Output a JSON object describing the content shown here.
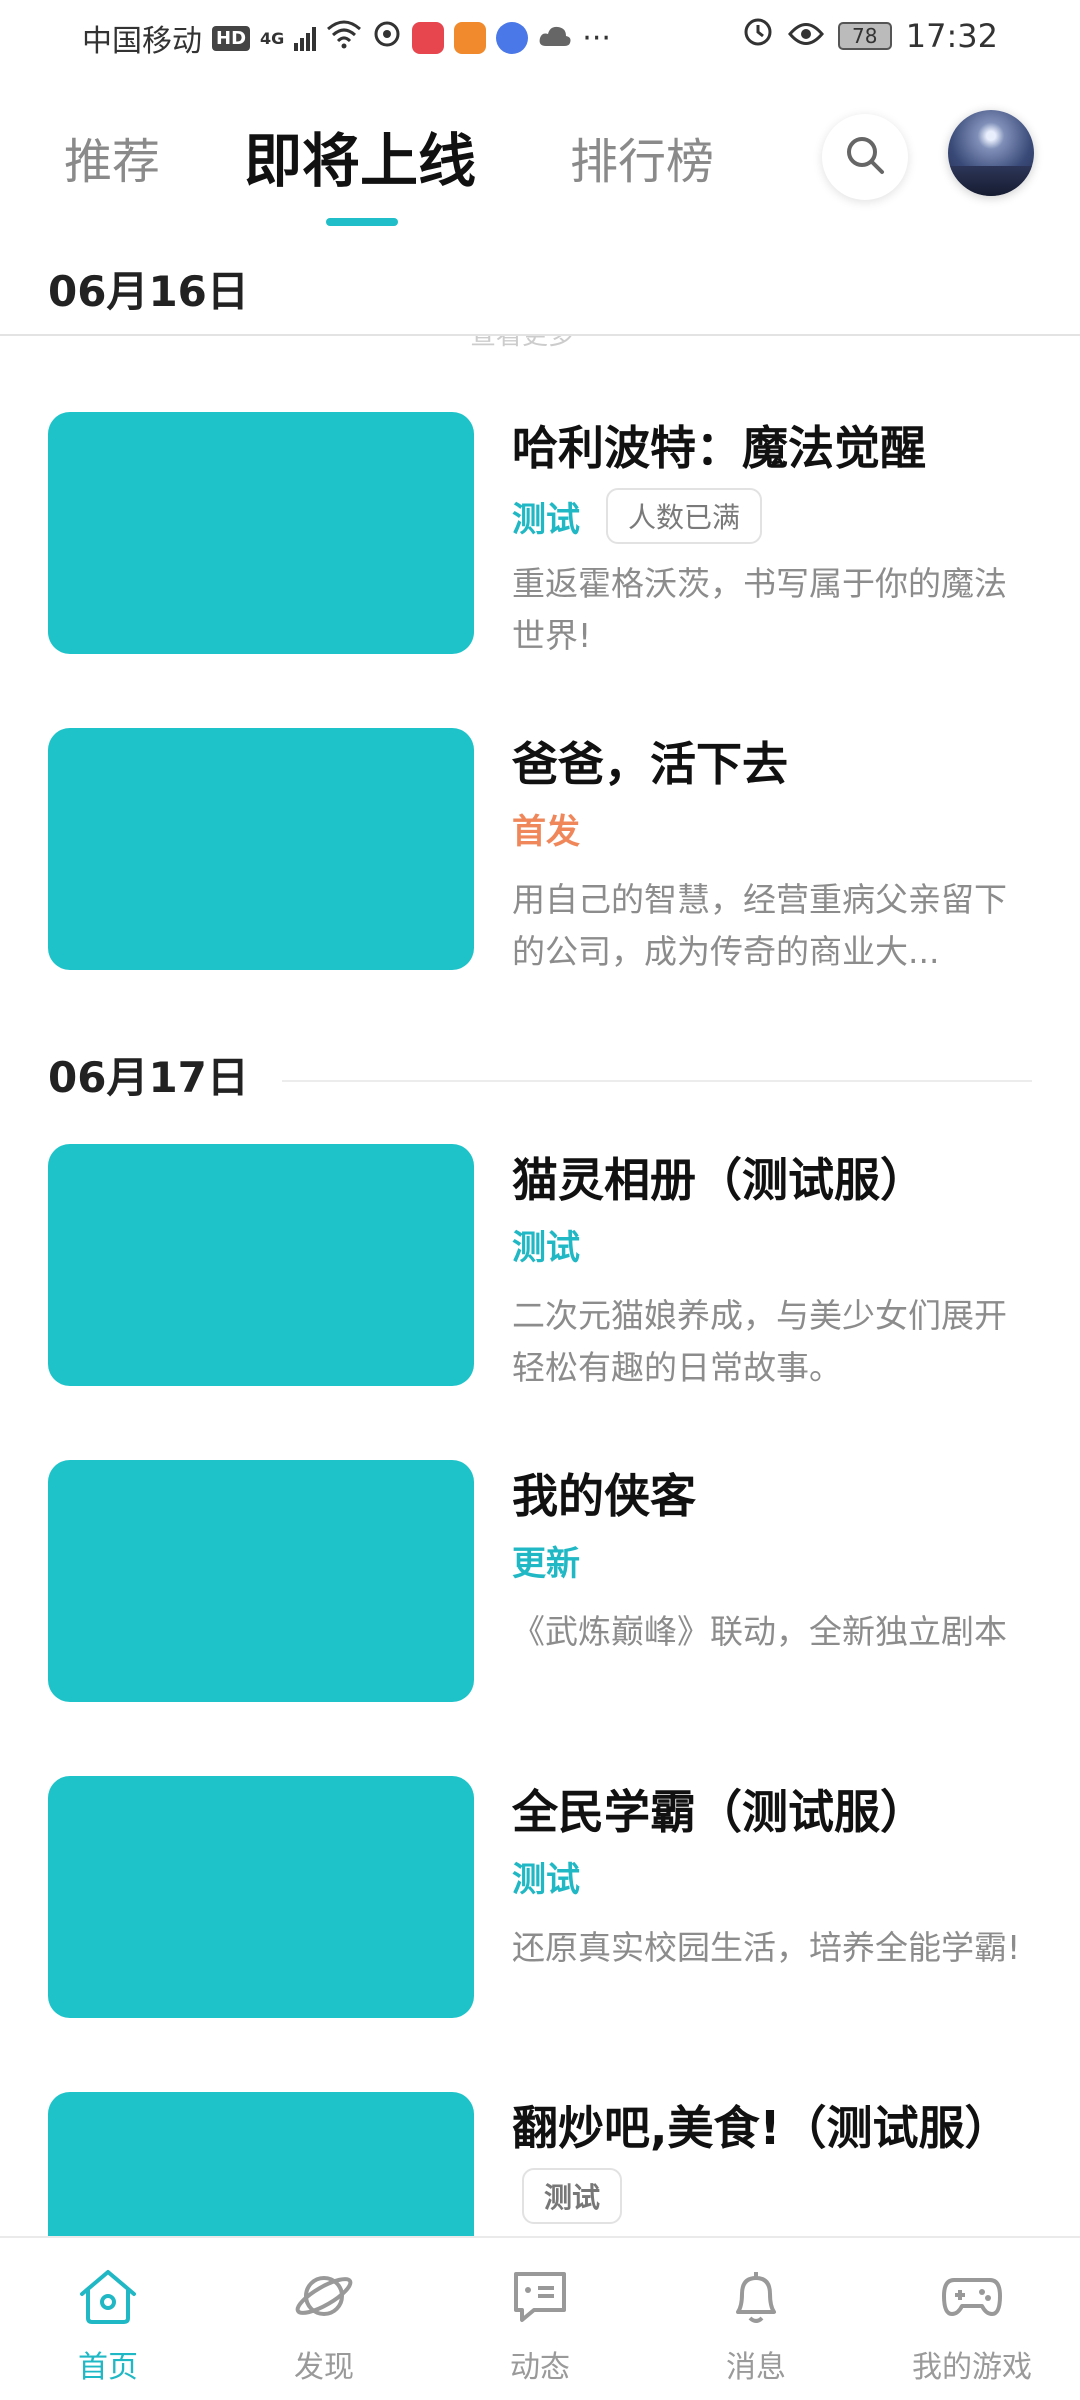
{
  "status_bar": {
    "carrier": "中国移动",
    "hd": "HD",
    "network": "4G",
    "battery": "78",
    "time": "17:32",
    "more": "···"
  },
  "tabs": [
    {
      "label": "推荐"
    },
    {
      "label": "即将上线"
    },
    {
      "label": "排行榜"
    }
  ],
  "sections": [
    {
      "date": "06月16日",
      "peek": "查看更多",
      "items": [
        {
          "title": "哈利波特：魔法觉醒",
          "tag": "测试",
          "tag_extra": "人数已满",
          "desc": "重返霍格沃茨，书写属于你的魔法世界!"
        },
        {
          "title": "爸爸，活下去",
          "tag": "首发",
          "desc": "用自己的智慧，经营重病父亲留下的公司，成为传奇的商业大..."
        }
      ]
    },
    {
      "date": "06月17日",
      "items": [
        {
          "title": "猫灵相册（测试服）",
          "tag": "测试",
          "desc": "二次元猫娘养成，与美少女们展开轻松有趣的日常故事。"
        },
        {
          "title": "我的侠客",
          "tag": "更新",
          "desc": "《武炼巅峰》联动，全新独立剧本"
        },
        {
          "title": "全民学霸（测试服）",
          "tag": "测试",
          "desc": "还原真实校园生活，培养全能学霸!"
        },
        {
          "title": "翻炒吧,美食!（测试服）",
          "tag": "测试"
        }
      ]
    }
  ],
  "bottom_nav": [
    {
      "label": "首页",
      "icon": "home-icon"
    },
    {
      "label": "发现",
      "icon": "planet-icon"
    },
    {
      "label": "动态",
      "icon": "chat-icon"
    },
    {
      "label": "消息",
      "icon": "bell-icon"
    },
    {
      "label": "我的游戏",
      "icon": "gamepad-icon"
    }
  ],
  "colors": {
    "accent": "#20b8c4",
    "thumbnail": "#1dc3c9",
    "orange": "#f0875a"
  }
}
